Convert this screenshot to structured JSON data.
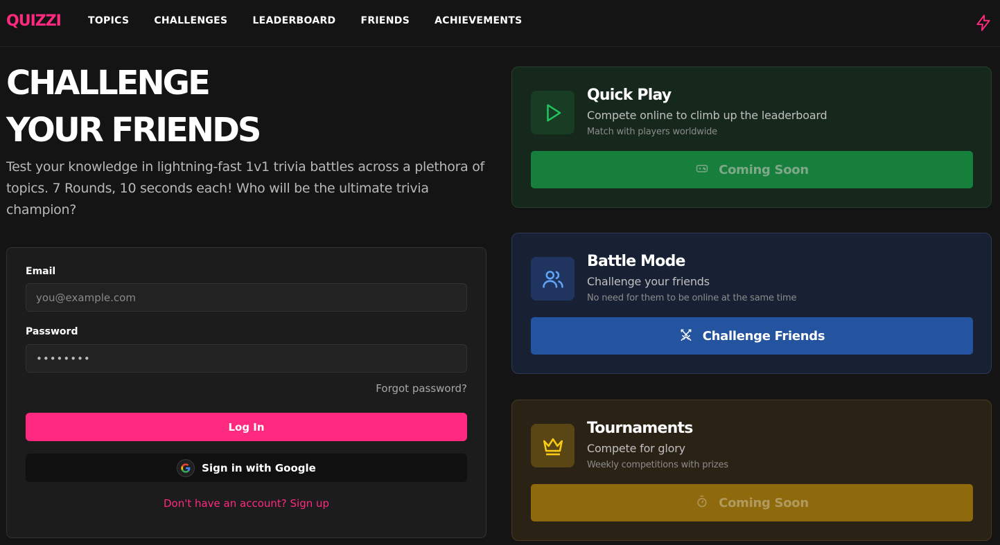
{
  "app": {
    "logo": "QUIZZI"
  },
  "nav": {
    "links": [
      "TOPICS",
      "CHALLENGES",
      "LEADERBOARD",
      "FRIENDS",
      "ACHIEVEMENTS"
    ],
    "bolt_icon": "lightning-bolt-icon"
  },
  "hero": {
    "title_line1": "CHALLENGE",
    "title_line2": "YOUR FRIENDS",
    "subtitle": "Test your knowledge in lightning-fast 1v1 trivia battles across a plethora of topics. 7 Rounds, 10 seconds each! Who will be the ultimate trivia champion?"
  },
  "login": {
    "email_label": "Email",
    "email_placeholder": "you@example.com",
    "password_label": "Password",
    "password_value": "••••••••",
    "forgot": "Forgot password?",
    "login_button": "Log In",
    "google_button": "Sign in with Google",
    "signup": "Don't have an account? Sign up"
  },
  "modes": [
    {
      "title": "Quick Play",
      "subtitle": "Compete online to climb up the leaderboard",
      "note": "Match with players worldwide",
      "button": "Coming Soon",
      "icon": "play-icon",
      "button_icon": "gamepad-icon",
      "accent": "#22c55e"
    },
    {
      "title": "Battle Mode",
      "subtitle": "Challenge your friends",
      "note": "No need for them to be online at the same time",
      "button": "Challenge Friends",
      "icon": "users-icon",
      "button_icon": "swords-icon",
      "accent": "#60a5fa"
    },
    {
      "title": "Tournaments",
      "subtitle": "Compete for glory",
      "note": "Weekly competitions with prizes",
      "button": "Coming Soon",
      "icon": "crown-icon",
      "button_icon": "timer-icon",
      "accent": "#facc15"
    }
  ],
  "colors": {
    "brand": "#ff2a7f",
    "background": "#141414"
  }
}
